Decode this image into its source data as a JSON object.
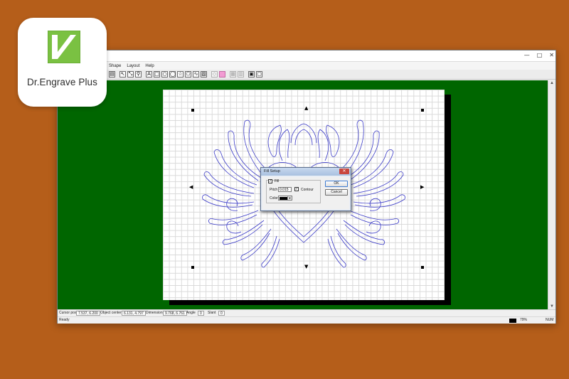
{
  "app": {
    "window_controls": [
      "—",
      "□",
      "✕"
    ],
    "menu": [
      "Shape",
      "Layout",
      "Help"
    ]
  },
  "toolbar": {
    "icons": [
      "save-icon",
      "select-arrow-icon",
      "node-edit-icon",
      "zoom-icon",
      "text-icon",
      "rectangle-icon",
      "circle-icon",
      "ellipse-icon",
      "star-icon",
      "polygon-icon",
      "freehand-icon",
      "weld-icon",
      "fill-setup-icon",
      "mirror-icon",
      "array-icon",
      "align-icon",
      "group-icon"
    ]
  },
  "fill_dialog": {
    "title": "Fill Setup",
    "close_glyph": "✕",
    "fill_label": "Fill",
    "fill_checked": true,
    "pitch_label": "Pitch",
    "pitch_value": "0.015",
    "contour_label": "Contour",
    "contour_checked": true,
    "color_label": "Color",
    "color_value": "#000000",
    "ok_label": "OK",
    "cancel_label": "Cancel"
  },
  "statusbar": {
    "cursor_label": "Cursor pos",
    "cursor_value": "7.537, 6.200",
    "center_label": "Object center",
    "center_value": "6.131, 4.797",
    "dimension_label": "Dimension",
    "dimension_value": "9.768, 6.761",
    "angle_label": "Angle",
    "angle_value": "0",
    "slant_label": "Slant",
    "slant_value": "0",
    "ready_text": "Ready",
    "zoom_text": "79%",
    "num_text": "NUM"
  },
  "colors": {
    "background": "#b55e1a",
    "workspace": "#006600",
    "design_stroke": "#3c3cc8",
    "logo_green": "#7ac142"
  },
  "logo": {
    "text": "Dr.Engrave Plus"
  }
}
